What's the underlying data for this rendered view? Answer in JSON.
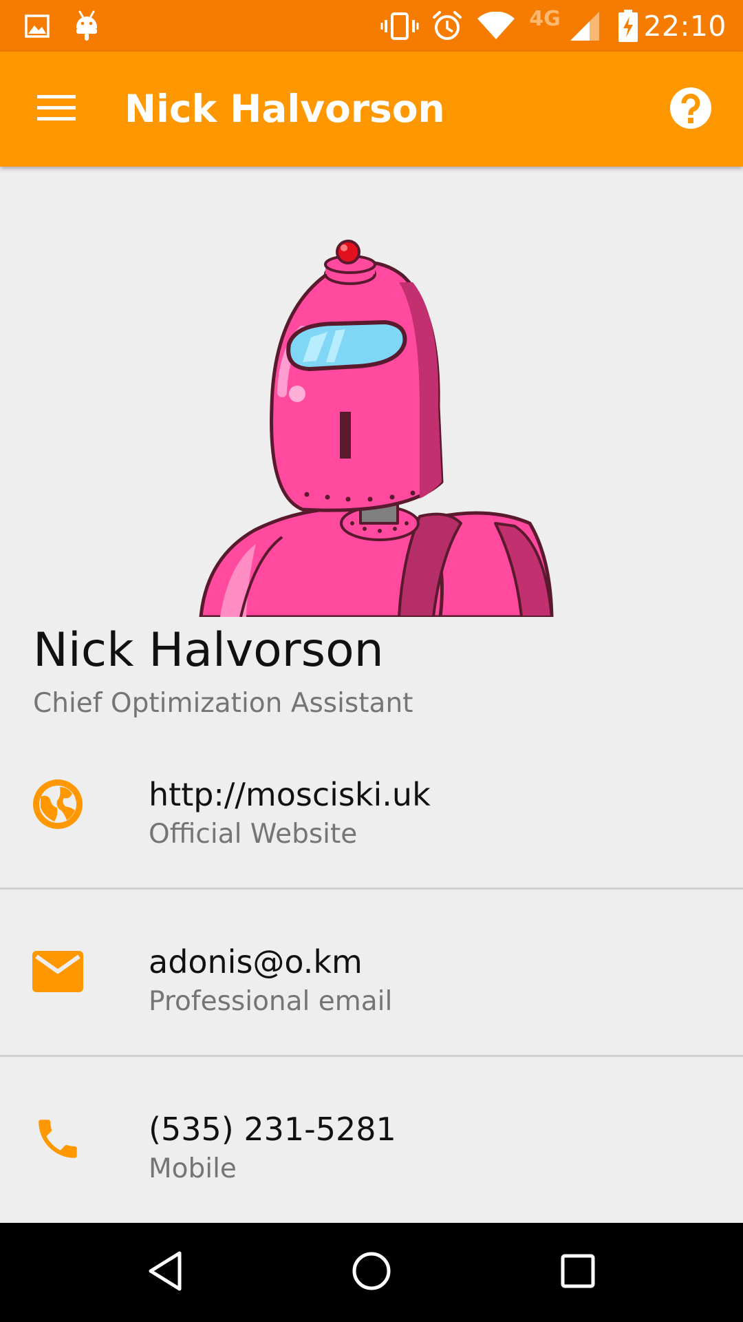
{
  "status_bar": {
    "time": "22:10",
    "network": "4G",
    "icons": [
      "image-icon",
      "android-icon",
      "vibrate-icon",
      "alarm-icon",
      "wifi-icon",
      "signal-icon",
      "battery-charging-icon"
    ]
  },
  "app_bar": {
    "title": "Nick Halvorson",
    "menu_icon": "menu-icon",
    "help_icon": "help-icon"
  },
  "profile": {
    "name": "Nick Halvorson",
    "role": "Chief Optimization Assistant",
    "avatar": "robot-avatar"
  },
  "contacts": [
    {
      "icon": "globe-icon",
      "value": "http://mosciski.uk",
      "label": "Official Website"
    },
    {
      "icon": "email-icon",
      "value": "adonis@o.km",
      "label": "Professional email"
    },
    {
      "icon": "phone-icon",
      "value": "(535) 231-5281",
      "label": "Mobile"
    }
  ],
  "nav_bar": {
    "buttons": [
      "back-icon",
      "home-icon",
      "recents-icon"
    ]
  },
  "colors": {
    "status_bar": "#f57c00",
    "app_bar": "#ff9800",
    "accent": "#ff9800",
    "background": "#eeeeee",
    "avatar_pink": "#ff4aa0"
  }
}
